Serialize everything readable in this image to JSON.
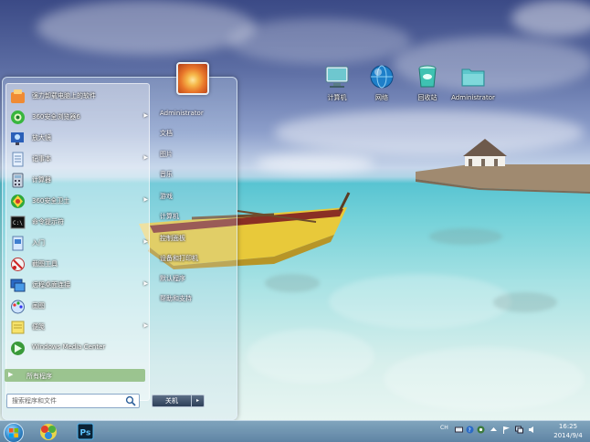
{
  "desktop": {
    "icons": [
      {
        "label": "计算机",
        "icon": "computer-icon"
      },
      {
        "label": "网络",
        "icon": "network-globe-icon"
      },
      {
        "label": "回收站",
        "icon": "recycle-bin-icon"
      },
      {
        "label": "Administrator",
        "icon": "user-folder-icon"
      }
    ]
  },
  "start_menu": {
    "programs": [
      {
        "label": "强力卸载电脑上的软件",
        "icon": "uninstaller-icon",
        "has_arrow": false
      },
      {
        "label": "360安全浏览器6",
        "icon": "browser-360-icon",
        "has_arrow": true
      },
      {
        "label": "放大镜",
        "icon": "magnifier-icon",
        "has_arrow": false
      },
      {
        "label": "记事本",
        "icon": "notepad-icon",
        "has_arrow": true
      },
      {
        "label": "计算器",
        "icon": "calculator-icon",
        "has_arrow": false
      },
      {
        "label": "360安全卫士",
        "icon": "security-360-icon",
        "has_arrow": true
      },
      {
        "label": "命令提示符",
        "icon": "cmd-icon",
        "has_arrow": false
      },
      {
        "label": "入门",
        "icon": "getting-started-icon",
        "has_arrow": true
      },
      {
        "label": "截图工具",
        "icon": "snipping-tool-icon",
        "has_arrow": false
      },
      {
        "label": "远程桌面连接",
        "icon": "remote-desktop-icon",
        "has_arrow": true
      },
      {
        "label": "画图",
        "icon": "paint-icon",
        "has_arrow": false
      },
      {
        "label": "便笺",
        "icon": "sticky-notes-icon",
        "has_arrow": true
      },
      {
        "label": "Windows Media Center",
        "icon": "media-center-icon",
        "has_arrow": false
      }
    ],
    "all_programs_label": "所有程序",
    "search_placeholder": "搜索程序和文件",
    "right_links": [
      "Administrator",
      "文档",
      "图片",
      "音乐",
      "游戏",
      "计算机",
      "控制面板",
      "设备和打印机",
      "默认程序",
      "帮助和支持"
    ],
    "shutdown_label": "关机",
    "shutdown_arrow": "▸"
  },
  "taskbar": {
    "pinned": [
      {
        "name": "start-button"
      },
      {
        "name": "browser-360-taskbar-icon"
      },
      {
        "name": "photoshop-taskbar-icon",
        "text": "Ps"
      }
    ],
    "tray": {
      "language": "CH",
      "time": "16:25",
      "date": "2014/9/4"
    }
  },
  "colors": {
    "menu_text": "#ffffff",
    "all_programs_highlight": "#82b46e",
    "taskbar": "#5078a0"
  }
}
